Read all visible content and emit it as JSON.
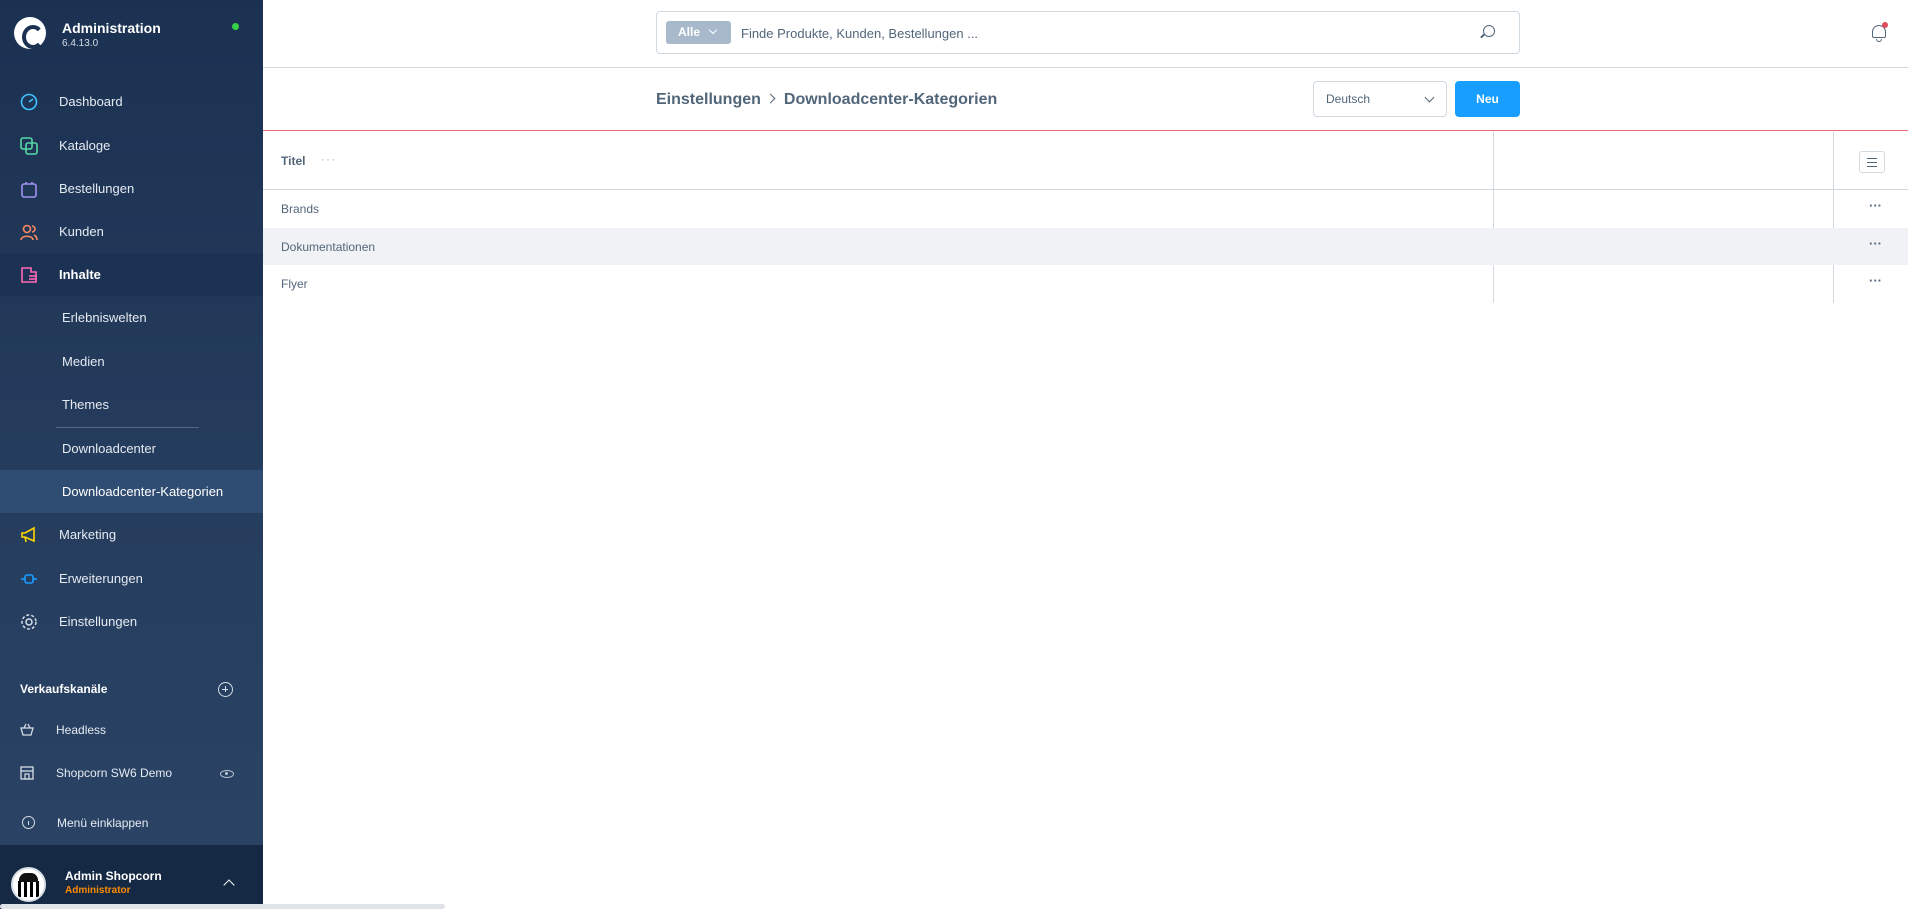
{
  "app": {
    "title": "Administration",
    "version": "6.4.13.0"
  },
  "sidebar": {
    "items": [
      {
        "label": "Dashboard",
        "icon": "gauge-icon",
        "color": "#40c4ff"
      },
      {
        "label": "Kataloge",
        "icon": "layers-icon",
        "color": "#57d9a3"
      },
      {
        "label": "Bestellungen",
        "icon": "bag-icon",
        "color": "#a092f0"
      },
      {
        "label": "Kunden",
        "icon": "users-icon",
        "color": "#f88962"
      },
      {
        "label": "Inhalte",
        "icon": "content-icon",
        "color": "#ff68b4"
      },
      {
        "label": "Marketing",
        "icon": "megaphone-icon",
        "color": "#ffd700"
      },
      {
        "label": "Erweiterungen",
        "icon": "plug-icon",
        "color": "#189eff"
      },
      {
        "label": "Einstellungen",
        "icon": "gear-icon",
        "color": "#d8dee6"
      }
    ],
    "sub_items": [
      "Erlebniswelten",
      "Medien",
      "Themes",
      "Downloadcenter",
      "Downloadcenter-Kategorien"
    ],
    "sales_channels_title": "Verkaufskanäle",
    "channels": [
      {
        "label": "Headless",
        "icon": "basket-icon"
      },
      {
        "label": "Shopcorn SW6 Demo",
        "icon": "storefront-icon"
      }
    ],
    "collapse_label": "Menü einklappen",
    "user": {
      "name": "Admin Shopcorn",
      "role": "Administrator"
    }
  },
  "search": {
    "type_label": "Alle",
    "placeholder": "Finde Produkte, Kunden, Bestellungen ..."
  },
  "header": {
    "breadcrumb": [
      "Einstellungen",
      "Downloadcenter-Kategorien"
    ],
    "language": "Deutsch",
    "new_label": "Neu"
  },
  "grid": {
    "columns": [
      "Titel"
    ],
    "rows": [
      {
        "title": "Brands"
      },
      {
        "title": "Dokumentationen"
      },
      {
        "title": "Flyer"
      }
    ]
  },
  "colors": {
    "accent": "#189eff",
    "sidebar_bg": "#1b3152",
    "online": "#37d046",
    "notification": "#e04d5c",
    "role": "#ff8c00"
  }
}
